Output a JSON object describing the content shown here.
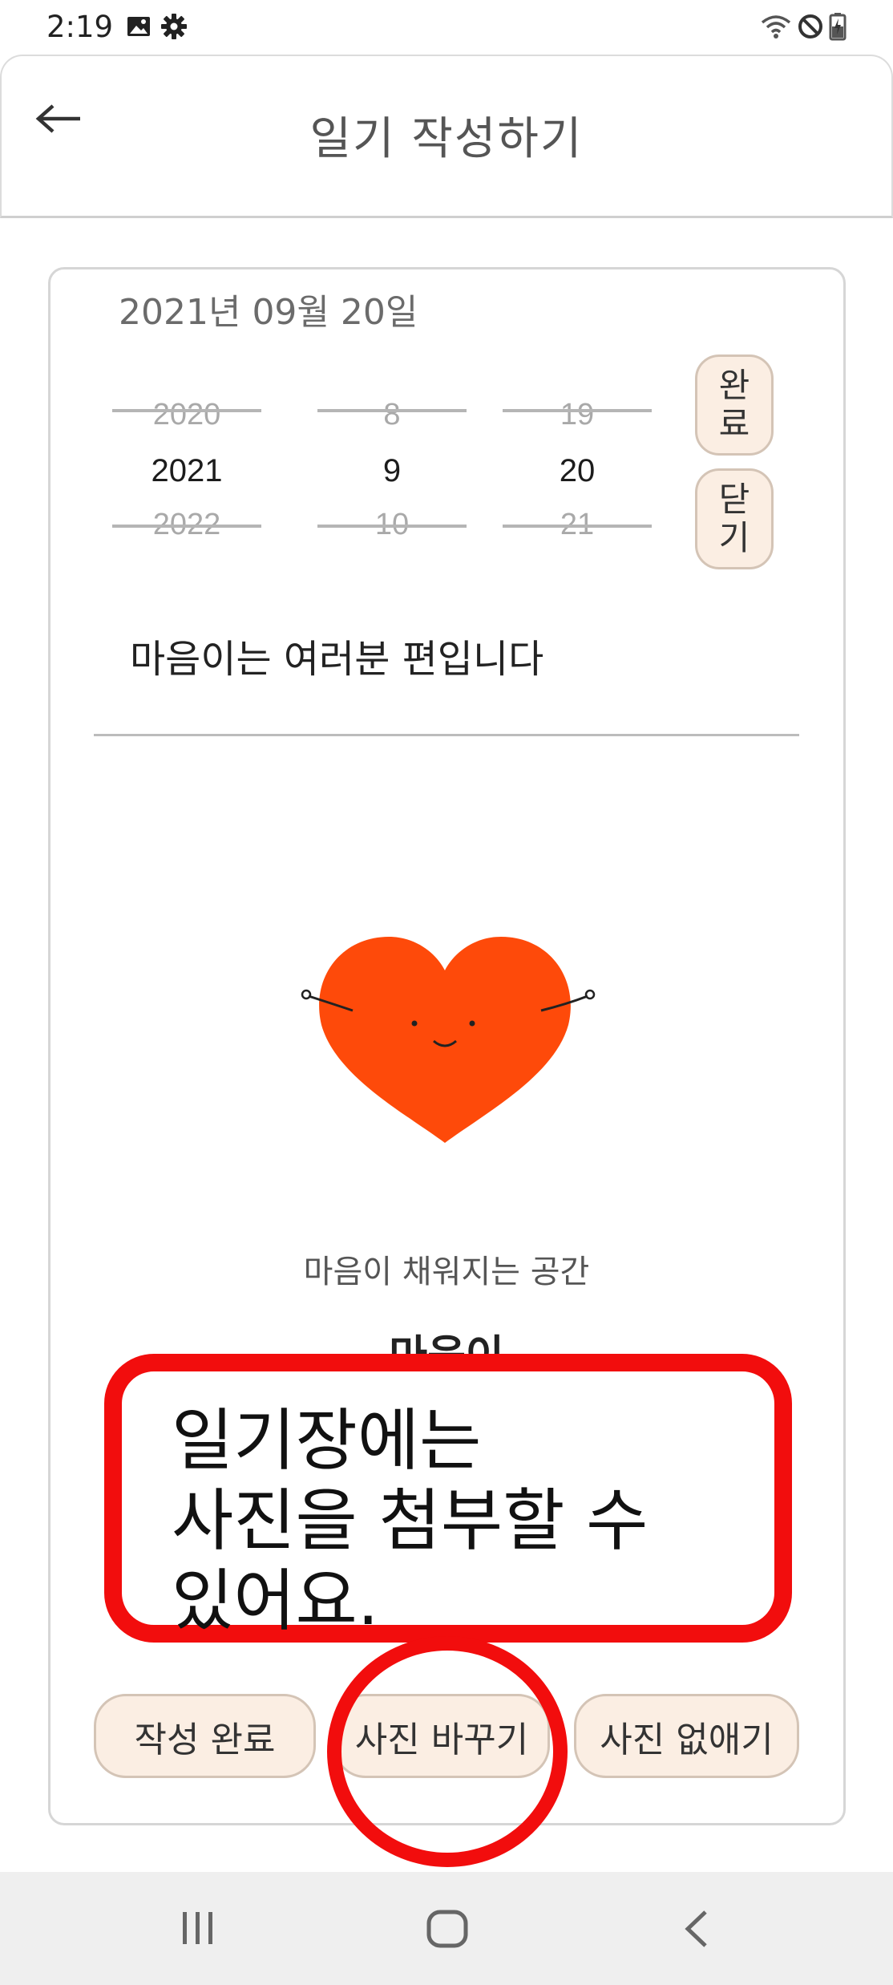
{
  "status_bar": {
    "time": "2:19",
    "icons": [
      "image-icon",
      "gear-icon",
      "wifi-icon",
      "do-not-disturb-icon",
      "battery-icon"
    ]
  },
  "app_bar": {
    "title": "일기 작성하기",
    "back_icon": "back-arrow-icon"
  },
  "diary": {
    "date_header": "2021년 09월 20일",
    "picker": {
      "year": {
        "prev": "2020",
        "selected": "2021",
        "next": "2022"
      },
      "month": {
        "prev": "8",
        "selected": "9",
        "next": "10"
      },
      "day": {
        "prev": "19",
        "selected": "20",
        "next": "21"
      }
    },
    "confirm_label": "완료",
    "close_label": "닫기",
    "text": "마음이는 여러분 편입니다",
    "photo_caption": "마음이 채워지는 공간",
    "photo_brand": "마음이"
  },
  "callout": {
    "text": "일기장에는\n사진을 첨부할 수\n있어요."
  },
  "actions": {
    "submit": "작성 완료",
    "change_photo": "사진 바꾸기",
    "remove_photo": "사진 없애기"
  },
  "colors": {
    "button_fill": "#fbeee3",
    "button_border": "#d4c4b6",
    "heart": "#fe4a0a",
    "annotation": "#f20d0d"
  },
  "nav": {
    "icons": [
      "recent-apps-icon",
      "home-icon",
      "back-icon"
    ]
  }
}
